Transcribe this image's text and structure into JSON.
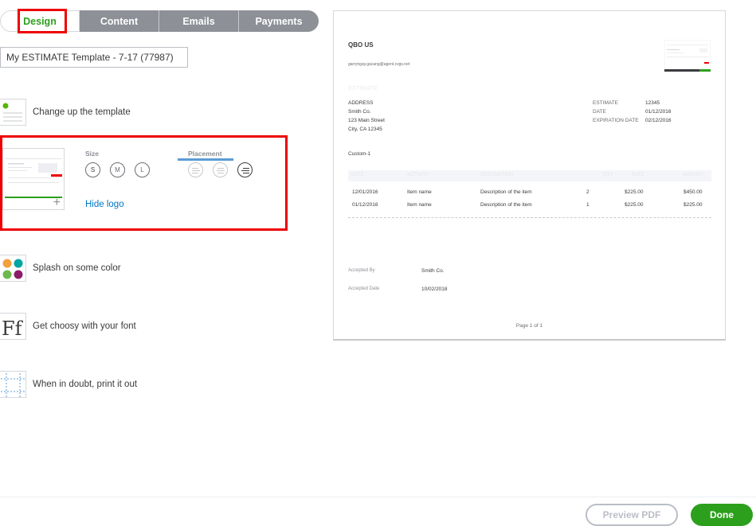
{
  "tabs": [
    {
      "label": "Design",
      "active": true
    },
    {
      "label": "Content",
      "active": false
    },
    {
      "label": "Emails",
      "active": false
    },
    {
      "label": "Payments",
      "active": false
    }
  ],
  "template_name": {
    "value": "My ESTIMATE Template - 7-17 (77987)"
  },
  "options": {
    "change_template": "Change up the template",
    "splash_color": "Splash on some color",
    "font": "Get choosy with your font",
    "print": "When in doubt, print it out"
  },
  "logo_panel": {
    "size_label": "Size",
    "sizes": [
      "S",
      "M",
      "L"
    ],
    "selected_size": "S",
    "placement_label": "Placement",
    "selected_placement": "right",
    "hide_logo": "Hide logo"
  },
  "colors": {
    "accent_green": "#2ca01c",
    "highlight_red": "#e00000",
    "link_blue": "#0077c5",
    "swatches": [
      "#f2a13c",
      "#00a6a4",
      "#6cb84e",
      "#8c1c6b"
    ]
  },
  "preview": {
    "company": "QBO US",
    "email": "garryngay.gacang@agent.cvgs.net",
    "doc_title": "ESTIMATE",
    "address_label": "ADDRESS",
    "address_lines": [
      "Smith Co.",
      "123 Main Street",
      "City, CA 12345"
    ],
    "meta": [
      {
        "key": "ESTIMATE",
        "value": "12345"
      },
      {
        "key": "DATE",
        "value": "01/12/2016"
      },
      {
        "key": "EXPIRATION DATE",
        "value": "02/12/2016"
      }
    ],
    "custom_field": "Custom-1",
    "columns": [
      "DATE",
      "ACTIVITY",
      "DESCRIPTION",
      "QTY",
      "RATE",
      "AMOUNT"
    ],
    "rows": [
      {
        "date": "12/01/2016",
        "activity": "Item name",
        "description": "Description of the item",
        "qty": "2",
        "rate": "$225.00",
        "amount": "$450.00"
      },
      {
        "date": "01/12/2016",
        "activity": "Item name",
        "description": "Description of the item",
        "qty": "1",
        "rate": "$225.00",
        "amount": "$225.00"
      }
    ],
    "accepted_by_label": "Accepted By",
    "accepted_by_value": "Smith Co.",
    "accepted_date_label": "Accepted Date",
    "accepted_date_value": "10/02/2018",
    "page": "Page 1 of 1"
  },
  "footer": {
    "preview_pdf": "Preview PDF",
    "done": "Done"
  }
}
